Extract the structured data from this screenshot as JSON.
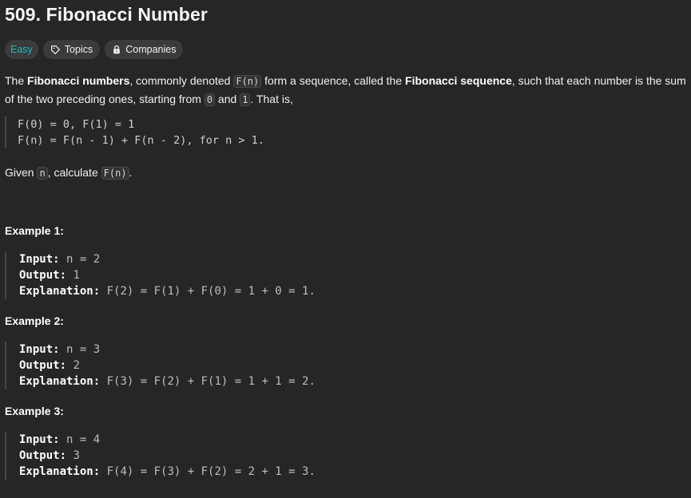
{
  "problem": {
    "title": "509. Fibonacci Number",
    "difficulty": "Easy",
    "topics_label": "Topics",
    "companies_label": "Companies"
  },
  "description": {
    "p1_a": "The ",
    "p1_b": "Fibonacci numbers",
    "p1_c": ", commonly denoted ",
    "p1_code1": "F(n)",
    "p1_d": " form a sequence, called the ",
    "p1_e": "Fibonacci sequence",
    "p1_f": ", such that each number is the sum of the two preceding ones, starting from ",
    "p1_code2": "0",
    "p1_g": " and ",
    "p1_code3": "1",
    "p1_h": ". That is,",
    "formula_line1": "F(0) = 0, F(1) = 1",
    "formula_line2": "F(n) = F(n - 1) + F(n - 2), for n > 1.",
    "given_a": "Given ",
    "given_code1": "n",
    "given_b": ", calculate ",
    "given_code2": "F(n)",
    "given_c": "."
  },
  "examples": [
    {
      "title": "Example 1:",
      "input_label": "Input:",
      "input": " n = 2",
      "output_label": "Output:",
      "output": " 1",
      "explanation_label": "Explanation:",
      "explanation": " F(2) = F(1) + F(0) = 1 + 0 = 1."
    },
    {
      "title": "Example 2:",
      "input_label": "Input:",
      "input": " n = 3",
      "output_label": "Output:",
      "output": " 2",
      "explanation_label": "Explanation:",
      "explanation": " F(3) = F(2) + F(1) = 1 + 1 = 2."
    },
    {
      "title": "Example 3:",
      "input_label": "Input:",
      "input": " n = 4",
      "output_label": "Output:",
      "output": " 3",
      "explanation_label": "Explanation:",
      "explanation": " F(4) = F(3) + F(2) = 2 + 1 = 3."
    }
  ],
  "colors": {
    "background": "#262626",
    "easy": "#1cbaba",
    "tag_bg": "#3b3b3b"
  }
}
